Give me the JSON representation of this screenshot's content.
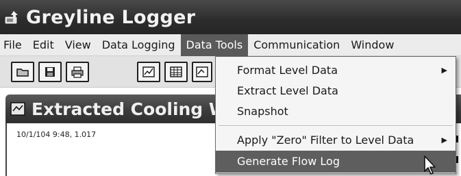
{
  "app": {
    "title": "Greyline Logger",
    "title_icon": "app-icon"
  },
  "menubar": {
    "items": [
      {
        "label": "File"
      },
      {
        "label": "Edit"
      },
      {
        "label": "View"
      },
      {
        "label": "Data Logging"
      },
      {
        "label": "Data Tools",
        "active": true
      },
      {
        "label": "Communication"
      },
      {
        "label": "Window"
      }
    ]
  },
  "toolbar": {
    "buttons": [
      {
        "icon": "open-folder-icon"
      },
      {
        "icon": "save-disk-icon"
      },
      {
        "icon": "print-icon"
      },
      {
        "icon": "chart-icon"
      },
      {
        "icon": "table-grid-icon"
      },
      {
        "icon": "data-icon"
      }
    ]
  },
  "child_window": {
    "title": "Extracted Cooling W",
    "icon": "window-icon",
    "data_line": "10/1/104 9:48, 1.017"
  },
  "dropdown": {
    "items": [
      {
        "label": "Format  Level Data",
        "submenu": true
      },
      {
        "label": "Extract  Level Data",
        "submenu": false
      },
      {
        "label": "Snapshot",
        "submenu": false
      },
      {
        "label": "Apply \"Zero\" Filter to  Level Data",
        "submenu": true
      },
      {
        "label": "Generate Flow Log",
        "submenu": false,
        "highlighted": true
      }
    ],
    "submenu_arrow": "▶"
  },
  "colors": {
    "titlebar": "#2c2c2c",
    "menu_active": "#5a5a5a",
    "highlight": "#5e5e5e"
  }
}
